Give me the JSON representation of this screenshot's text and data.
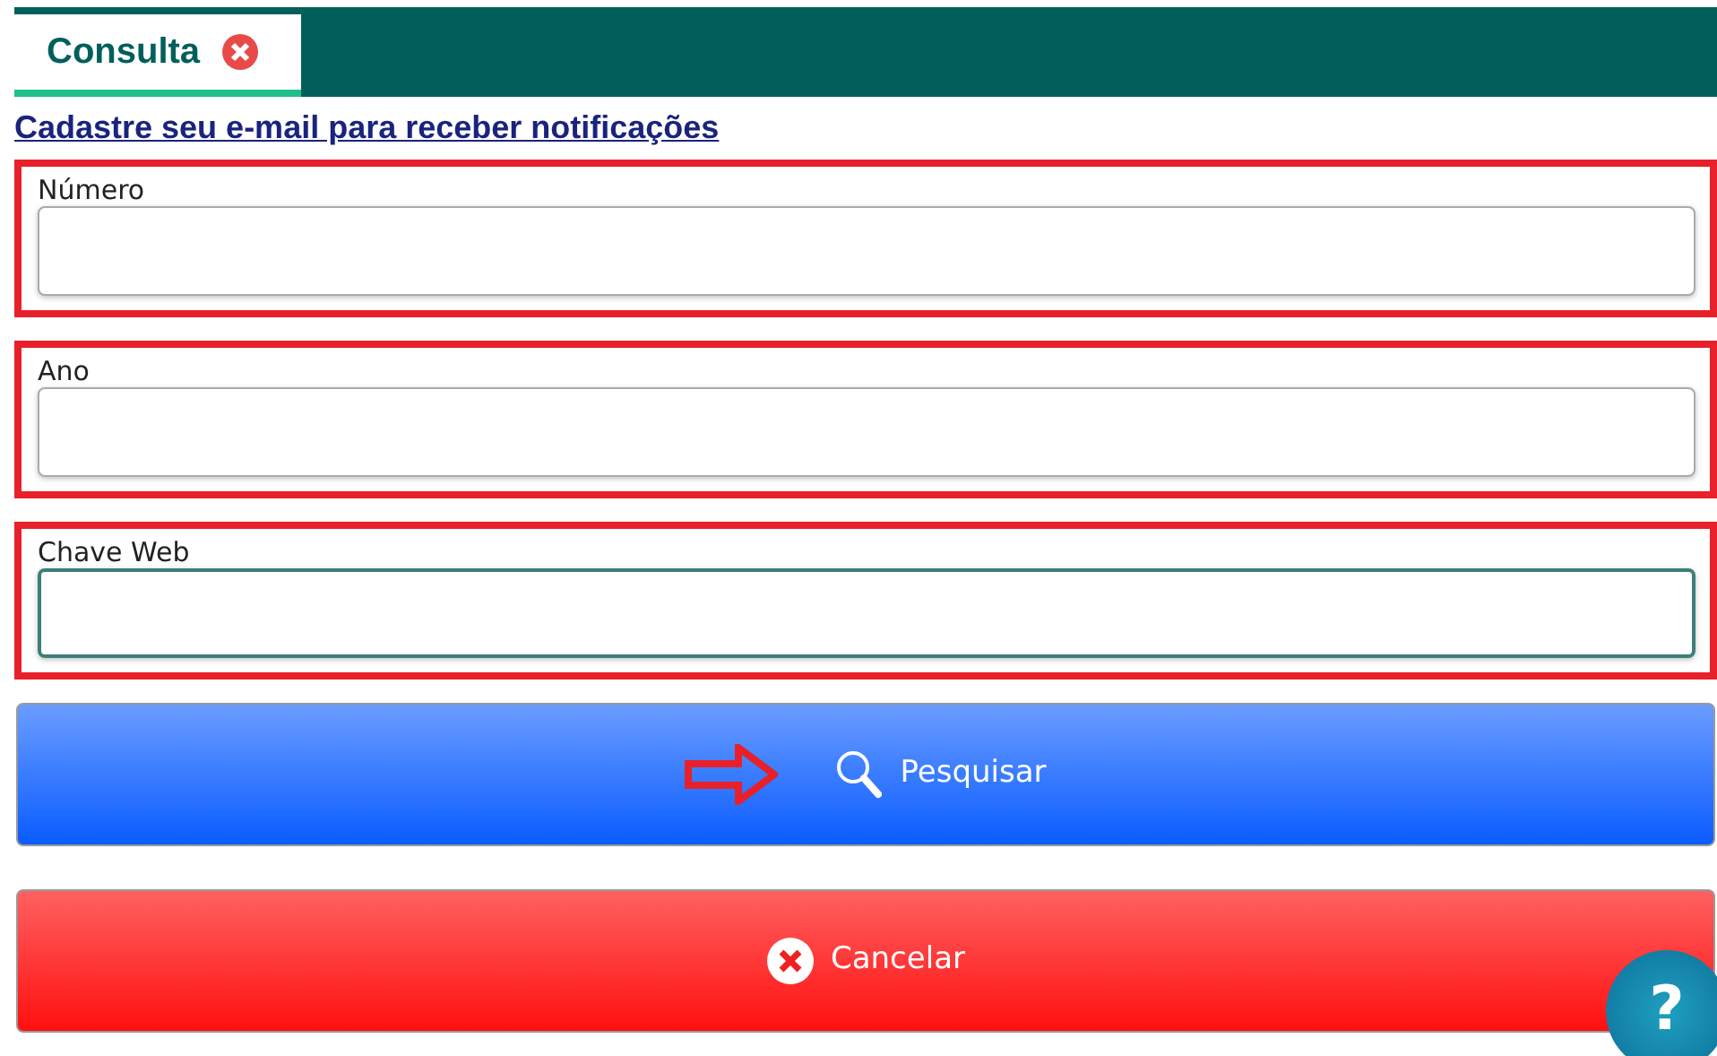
{
  "tabs": [
    {
      "label": "Consulta",
      "selected": true,
      "closable": true
    }
  ],
  "link": "Cadastre seu e-mail para receber notificações",
  "fields": [
    {
      "label": "Número",
      "highlighted": true,
      "focused": false
    },
    {
      "label": "Ano",
      "highlighted": true,
      "focused": false
    },
    {
      "label": "Chave Web",
      "highlighted": true,
      "focused": true
    }
  ],
  "buttons": [
    {
      "label": "Pesquisar",
      "kind": "search",
      "pointer_arrow": true
    },
    {
      "label": "Cancelar",
      "kind": "cancel",
      "pointer_arrow": false
    }
  ],
  "help": {
    "label": "?"
  }
}
